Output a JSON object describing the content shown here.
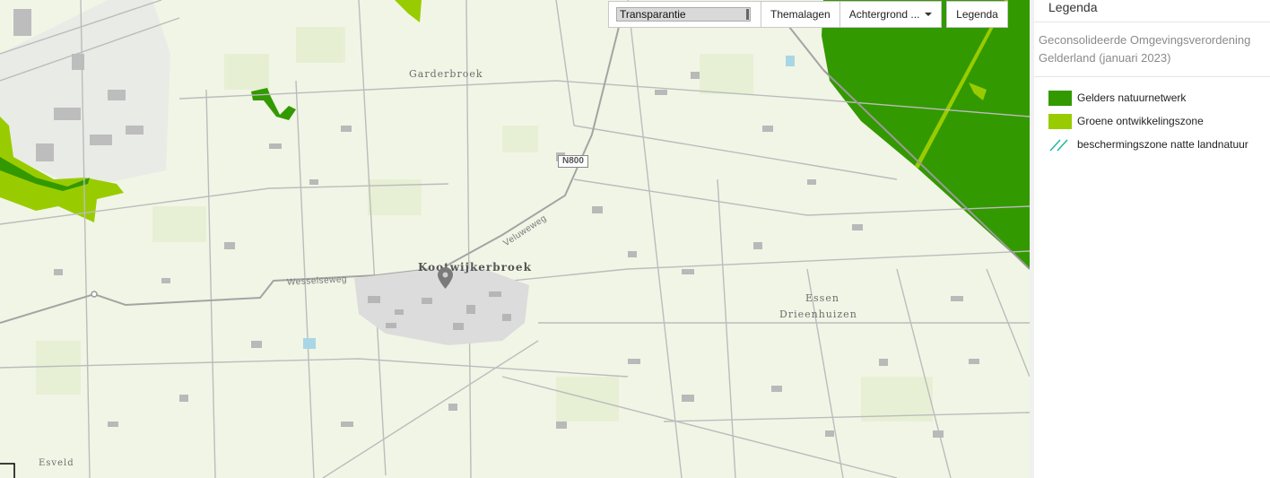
{
  "toolbar": {
    "transparency_label": "Transparantie",
    "themalagen_label": "Themalagen",
    "achtergrond_label": "Achtergrond ...",
    "legenda_label": "Legenda"
  },
  "map": {
    "places": {
      "garderbroek": "Garderbroek",
      "kootwijkerbroek": "Kootwijkerbroek",
      "essen": "Essen",
      "drieenhuizen": "Drieenhuizen",
      "esveld": "Esveld"
    },
    "roads": {
      "wesselseweg": "Wesselseweg",
      "veluweweg": "Veluweweg",
      "n800": "N800"
    },
    "colors": {
      "background": "#f1f5e6",
      "natuurnetwerk": "#339900",
      "ontwikkelingszone": "#99cc00",
      "road": "#a8a8a8",
      "built": "#b8b8b8"
    },
    "marker_icon": "map-pin-icon"
  },
  "legend": {
    "title": "Legenda",
    "subtitle": "Geconsolideerde Omgevingsverordening Gelderland (januari 2023)",
    "items": [
      {
        "label": "Gelders natuurnetwerk",
        "color": "#339900"
      },
      {
        "label": "Groene ontwikkelingszone",
        "color": "#99cc00"
      },
      {
        "label": "beschermingszone natte landnatuur",
        "color": "#1fb89a"
      }
    ]
  }
}
